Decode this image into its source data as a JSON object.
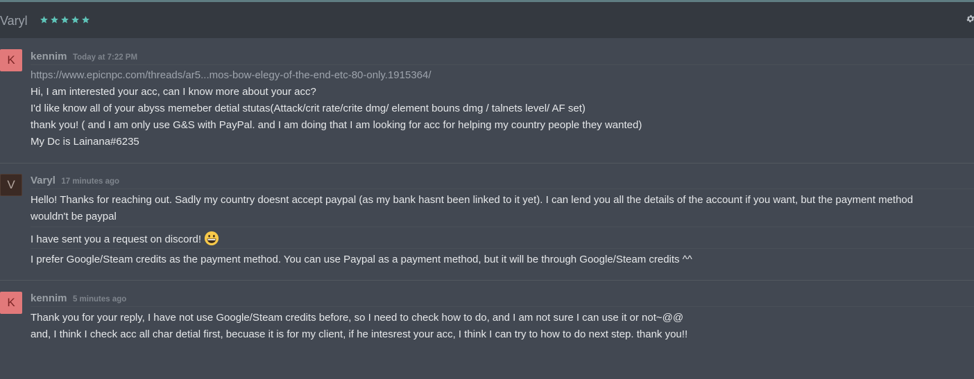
{
  "header": {
    "name": "Varyl",
    "stars": "★★★★★",
    "settings_icon": "gear-icon",
    "star_color": "#5ec4b8"
  },
  "messages": [
    {
      "avatar_letter": "K",
      "author": "kennim",
      "time": "Today at 7:22 PM",
      "lines": [
        "https://www.epicnpc.com/threads/ar5...mos-bow-elegy-of-the-end-etc-80-only.1915364/",
        "Hi, I am interested your acc, can I know more about your acc?",
        "I'd like know all of your abyss memeber detial stutas(Attack/crit rate/crite dmg/ element bouns dmg / talnets level/ AF set)",
        "thank you! ( and I am only use G&S with PayPal. and I am doing that I am looking for acc for helping my country people they wanted)",
        "My Dc is Lainana#6235"
      ]
    },
    {
      "avatar_letter": "V",
      "author": "Varyl",
      "time": "17 minutes ago",
      "lines": [
        "Hello! Thanks for reaching out. Sadly my country doesnt accept paypal (as my bank hasnt been linked to it yet). I can lend you all the details of the account if you want, but the payment method",
        "wouldn't be paypal",
        "I have sent you a request on discord!",
        "I prefer Google/Steam credits as the payment method. You can use Paypal as a payment method, but it will be through Google/Steam credits ^^"
      ],
      "emoji": "grinning-face-emoji"
    },
    {
      "avatar_letter": "K",
      "author": "kennim",
      "time": "5 minutes ago",
      "lines": [
        "Thank you for your reply, I have not use Google/Steam credits before, so I need to check how to do, and I am not sure I can use it or not~@@",
        "and, I think I check acc all char detial first, becuase it is for my client, if he intesrest your acc, I think I can try to how to do next step. thank you!!"
      ]
    }
  ]
}
